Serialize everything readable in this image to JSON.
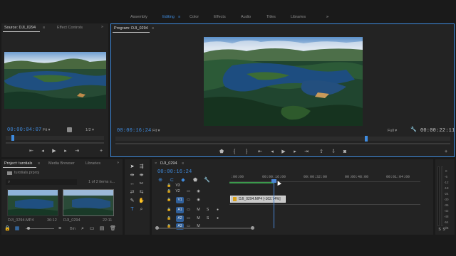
{
  "workspaces": {
    "items": [
      "Assembly",
      "Editing",
      "Color",
      "Effects",
      "Audio",
      "Titles",
      "Libraries"
    ],
    "active": "Editing",
    "more_icon": "double-chevron-right"
  },
  "source_monitor": {
    "tab_label": "Source: DJI_0294",
    "effect_controls_label": "Effect Controls",
    "timecode": "00:00:04:07",
    "fit": "Fit",
    "resolution": "1/2"
  },
  "program_monitor": {
    "tab_label": "Program: DJI_0294",
    "timecode": "00:00:16:24",
    "fit": "Fit",
    "quality": "Full",
    "duration": "00:00:22:11"
  },
  "project": {
    "tab_label": "Project: turotials",
    "media_browser_label": "Media Browser",
    "libraries_label": "Libraries",
    "file_name": "turotials.prproj",
    "items_count": "1 of 2 items s...",
    "clips": [
      {
        "name": "DJI_0294.MP4",
        "duration": "36:12"
      },
      {
        "name": "DJI_0294",
        "duration": "22:11"
      }
    ],
    "bin_label": "Bin"
  },
  "timeline": {
    "sequence_label": "DJI_0294",
    "timecode": "00:00:16:24",
    "ruler": [
      ":00:00",
      "00:00:16:00",
      "00:00:32:00",
      "00:00:48:00",
      "00:01:04:00"
    ],
    "tracks": [
      {
        "name": "V3"
      },
      {
        "name": "V2"
      },
      {
        "name": "V1"
      },
      {
        "name": "A1"
      },
      {
        "name": "A2"
      },
      {
        "name": "A3"
      }
    ],
    "clip_label": "DJI_0294.MP4 [-162.74%]",
    "audio_buttons": {
      "mute": "M",
      "solo": "S"
    }
  },
  "meters": {
    "labels": [
      "0",
      "-6",
      "-12",
      "-18",
      "-24",
      "-30",
      "-36",
      "-42",
      "-48",
      "-54",
      "dB"
    ]
  },
  "colors": {
    "accent": "#3f8ce0",
    "timecode": "#3f8ce0",
    "playhead": "#4a86d6",
    "selected_track": "#2f5f9a"
  }
}
